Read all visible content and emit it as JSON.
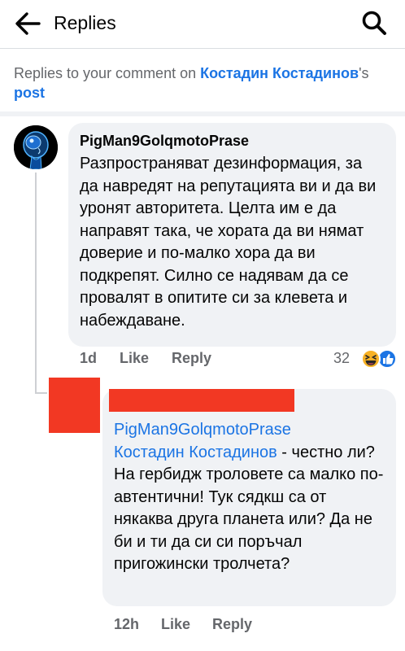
{
  "header": {
    "title": "Replies",
    "back_icon": "arrow-left-icon",
    "search_icon": "search-icon"
  },
  "context": {
    "prefix": "Replies to your comment on ",
    "name": "Костадин Костадинов",
    "suffix": "'s",
    "post": "post"
  },
  "comment": {
    "author": "PigMan9GolqmotoPrase",
    "text": "Разпространяват дезинформация, за да навредят на репутацията ви и да ви уронят авторитета. Целта им е да направят така, че хората да ви нямат доверие и по-малко хора да ви подкрепят. Силно се надявам да се провалят в опитите си за клевета и набеждаване.",
    "time": "1d",
    "like": "Like",
    "reply": "Reply",
    "reaction_count": "32",
    "reactions": [
      "haha-reaction-icon",
      "like-reaction-icon"
    ]
  },
  "reply": {
    "mention1": "PigMan9GolqmotoPrase",
    "mention2": "Костадин Костадинов",
    "text": " - честно ли? На гербидж троловете са малко по-автентични! Тук сядкш са от някаква друга планета или? Да не би и ти да си си поръчал пригожински тролчета?",
    "time": "12h",
    "like": "Like",
    "reply": "Reply"
  },
  "colors": {
    "accent": "#1b74e4",
    "bubble": "#f0f2f5",
    "secondary_text": "#65676b",
    "redaction": "#f23823"
  }
}
